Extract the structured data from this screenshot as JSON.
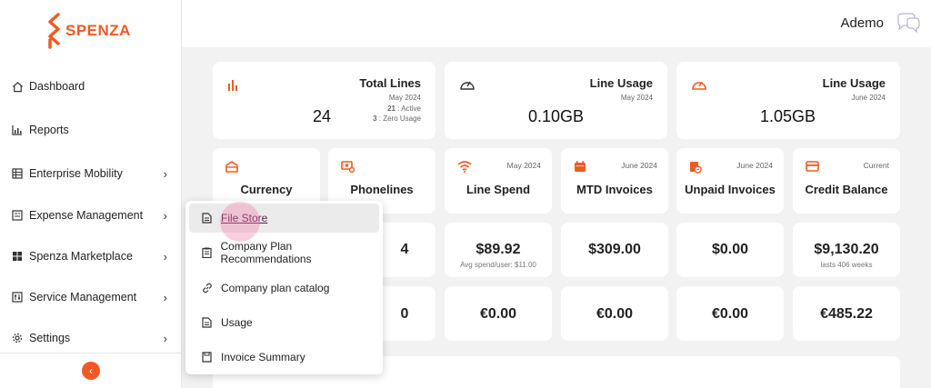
{
  "brand": {
    "name": "SPENZA",
    "color": "#f05a22"
  },
  "sidebar": {
    "items": [
      {
        "label": "Dashboard",
        "icon": "home-icon",
        "has_submenu": false
      },
      {
        "label": "Reports",
        "icon": "bar-chart-icon",
        "has_submenu": false
      },
      {
        "label": "Enterprise Mobility",
        "icon": "grid-icon",
        "has_submenu": true
      },
      {
        "label": "Expense Management",
        "icon": "receipt-icon",
        "has_submenu": true
      },
      {
        "label": "Spenza Marketplace",
        "icon": "apps-icon",
        "has_submenu": true
      },
      {
        "label": "Service Management",
        "icon": "settings-panel-icon",
        "has_submenu": true
      },
      {
        "label": "Settings",
        "icon": "gear-icon",
        "has_submenu": true
      }
    ],
    "collapse_icon": "chevron-left-icon"
  },
  "header": {
    "user_name": "Ademo",
    "avatar_icon": "chat-bubbles-icon"
  },
  "summary": {
    "total_lines": {
      "title": "Total Lines",
      "period": "May 2024",
      "value": "24",
      "active": "21",
      "active_label": ": Active",
      "zero_usage": "3",
      "zero_usage_label": ": Zero Usage"
    },
    "line_usage_may": {
      "title": "Line Usage",
      "period": "May 2024",
      "value": "0.10GB"
    },
    "line_usage_june": {
      "title": "Line Usage",
      "period": "June 2024",
      "value": "1.05GB"
    }
  },
  "stats": [
    {
      "label": "Currency",
      "date": "",
      "icon": "wallet-icon"
    },
    {
      "label": "Phonelines",
      "date": "",
      "icon": "money-icon"
    },
    {
      "label": "Line Spend",
      "date": "May 2024",
      "icon": "wifi-icon"
    },
    {
      "label": "MTD Invoices",
      "date": "June 2024",
      "icon": "calendar-icon"
    },
    {
      "label": "Unpaid Invoices",
      "date": "June 2024",
      "icon": "unpaid-icon"
    },
    {
      "label": "Credit Balance",
      "date": "Current",
      "icon": "credit-card-icon"
    }
  ],
  "usd_row": [
    {
      "value": "4",
      "note": ""
    },
    {
      "value": "$89.92",
      "note": "Avg spend/user: $11.00"
    },
    {
      "value": "$309.00",
      "note": ""
    },
    {
      "value": "$0.00",
      "note": ""
    },
    {
      "value": "$9,130.20",
      "note": "lasts 406 weeks"
    }
  ],
  "eur_row": [
    {
      "value": "0"
    },
    {
      "value": "€0.00"
    },
    {
      "value": "€0.00"
    },
    {
      "value": "€0.00"
    },
    {
      "value": "€485.22"
    }
  ],
  "dropdown": {
    "items": [
      {
        "label": "File Store",
        "icon": "document-icon",
        "active": true
      },
      {
        "label": "Company Plan Recommendations",
        "icon": "clipboard-icon",
        "active": false
      },
      {
        "label": "Company plan catalog",
        "icon": "link-icon",
        "active": false
      },
      {
        "label": "Usage",
        "icon": "document-icon",
        "active": false
      },
      {
        "label": "Invoice Summary",
        "icon": "page-icon",
        "active": false
      }
    ]
  }
}
